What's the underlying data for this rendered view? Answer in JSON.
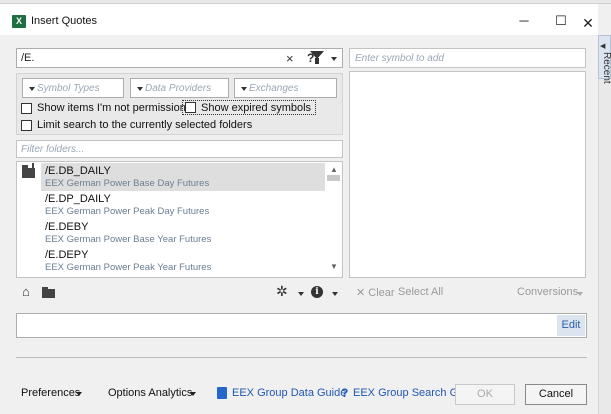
{
  "window": {
    "title": "Insert Quotes",
    "app_icon_text": "X",
    "minimize_glyph": "─",
    "maximize_glyph": "☐",
    "close_glyph": "✕"
  },
  "rail": {
    "label": "Recent",
    "arrow": "◀"
  },
  "search": {
    "value": "/E.",
    "clear_glyph": "×",
    "help_glyph": "?"
  },
  "add_symbol": {
    "placeholder": "Enter symbol to add"
  },
  "filters": {
    "symbol_types": "Symbol Types",
    "data_providers": "Data Providers",
    "exchanges": "Exchanges",
    "show_not_permissioned": "Show items I'm not permission...",
    "show_expired": "Show expired symbols",
    "limit_search": "Limit search to the currently selected folders"
  },
  "filter_folders": {
    "placeholder": "Filter folders..."
  },
  "results": [
    {
      "symbol": "/E.DB_DAILY",
      "description": "EEX German Power Base Day Futures",
      "selected": true
    },
    {
      "symbol": "/E.DP_DAILY",
      "description": "EEX German Power Peak Day Futures",
      "selected": false
    },
    {
      "symbol": "/E.DEBY",
      "description": "EEX German Power Base Year Futures",
      "selected": false
    },
    {
      "symbol": "/E.DEPY",
      "description": "EEX German Power Peak Year Futures",
      "selected": false
    }
  ],
  "toolbar": {
    "home_glyph": "⌂",
    "gear_glyph": "✲",
    "info_glyph": "i",
    "clear_label": "✕ Clear",
    "select_all_label": "Select All",
    "conversions_label": "Conversions"
  },
  "formula": {
    "value": "",
    "edit_label": "Edit"
  },
  "footer": {
    "preferences": "Preferences",
    "options_analytics": "Options Analytics",
    "data_guide": "EEX Group Data Guide",
    "search_guide_glyph": "?",
    "search_guide": "EEX Group Search Guide",
    "ok": "OK",
    "cancel": "Cancel"
  }
}
